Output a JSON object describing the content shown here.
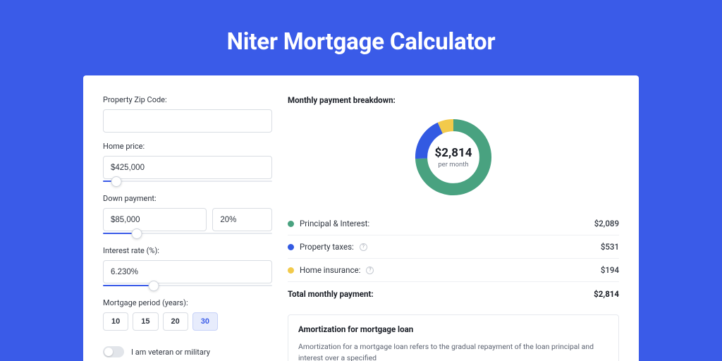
{
  "title": "Niter Mortgage Calculator",
  "form": {
    "zip": {
      "label": "Property Zip Code:",
      "value": ""
    },
    "homePrice": {
      "label": "Home price:",
      "value": "$425,000",
      "sliderPercent": 8
    },
    "downPayment": {
      "label": "Down payment:",
      "amount": "$85,000",
      "percent": "20%",
      "sliderPercent": 20
    },
    "interestRate": {
      "label": "Interest rate (%):",
      "value": "6.230%",
      "sliderPercent": 30
    },
    "period": {
      "label": "Mortgage period (years):",
      "options": [
        "10",
        "15",
        "20",
        "30"
      ],
      "selected": "30"
    },
    "veteran": {
      "label": "I am veteran or military",
      "checked": false
    }
  },
  "breakdown": {
    "title": "Monthly payment breakdown:",
    "centerAmount": "$2,814",
    "centerSub": "per month",
    "items": [
      {
        "label": "Principal & Interest:",
        "value": "$2,089",
        "color": "green",
        "info": false
      },
      {
        "label": "Property taxes:",
        "value": "$531",
        "color": "blue",
        "info": true
      },
      {
        "label": "Home insurance:",
        "value": "$194",
        "color": "yellow",
        "info": true
      }
    ],
    "totalLabel": "Total monthly payment:",
    "totalValue": "$2,814"
  },
  "amortization": {
    "title": "Amortization for mortgage loan",
    "text": "Amortization for a mortgage loan refers to the gradual repayment of the loan principal and interest over a specified"
  },
  "chart_data": {
    "type": "pie",
    "title": "Monthly payment breakdown",
    "series": [
      {
        "name": "Principal & Interest",
        "value": 2089,
        "color": "#49A280"
      },
      {
        "name": "Property taxes",
        "value": 531,
        "color": "#335AE2"
      },
      {
        "name": "Home insurance",
        "value": 194,
        "color": "#F2CA4B"
      }
    ],
    "total": 2814,
    "unit": "USD per month"
  }
}
